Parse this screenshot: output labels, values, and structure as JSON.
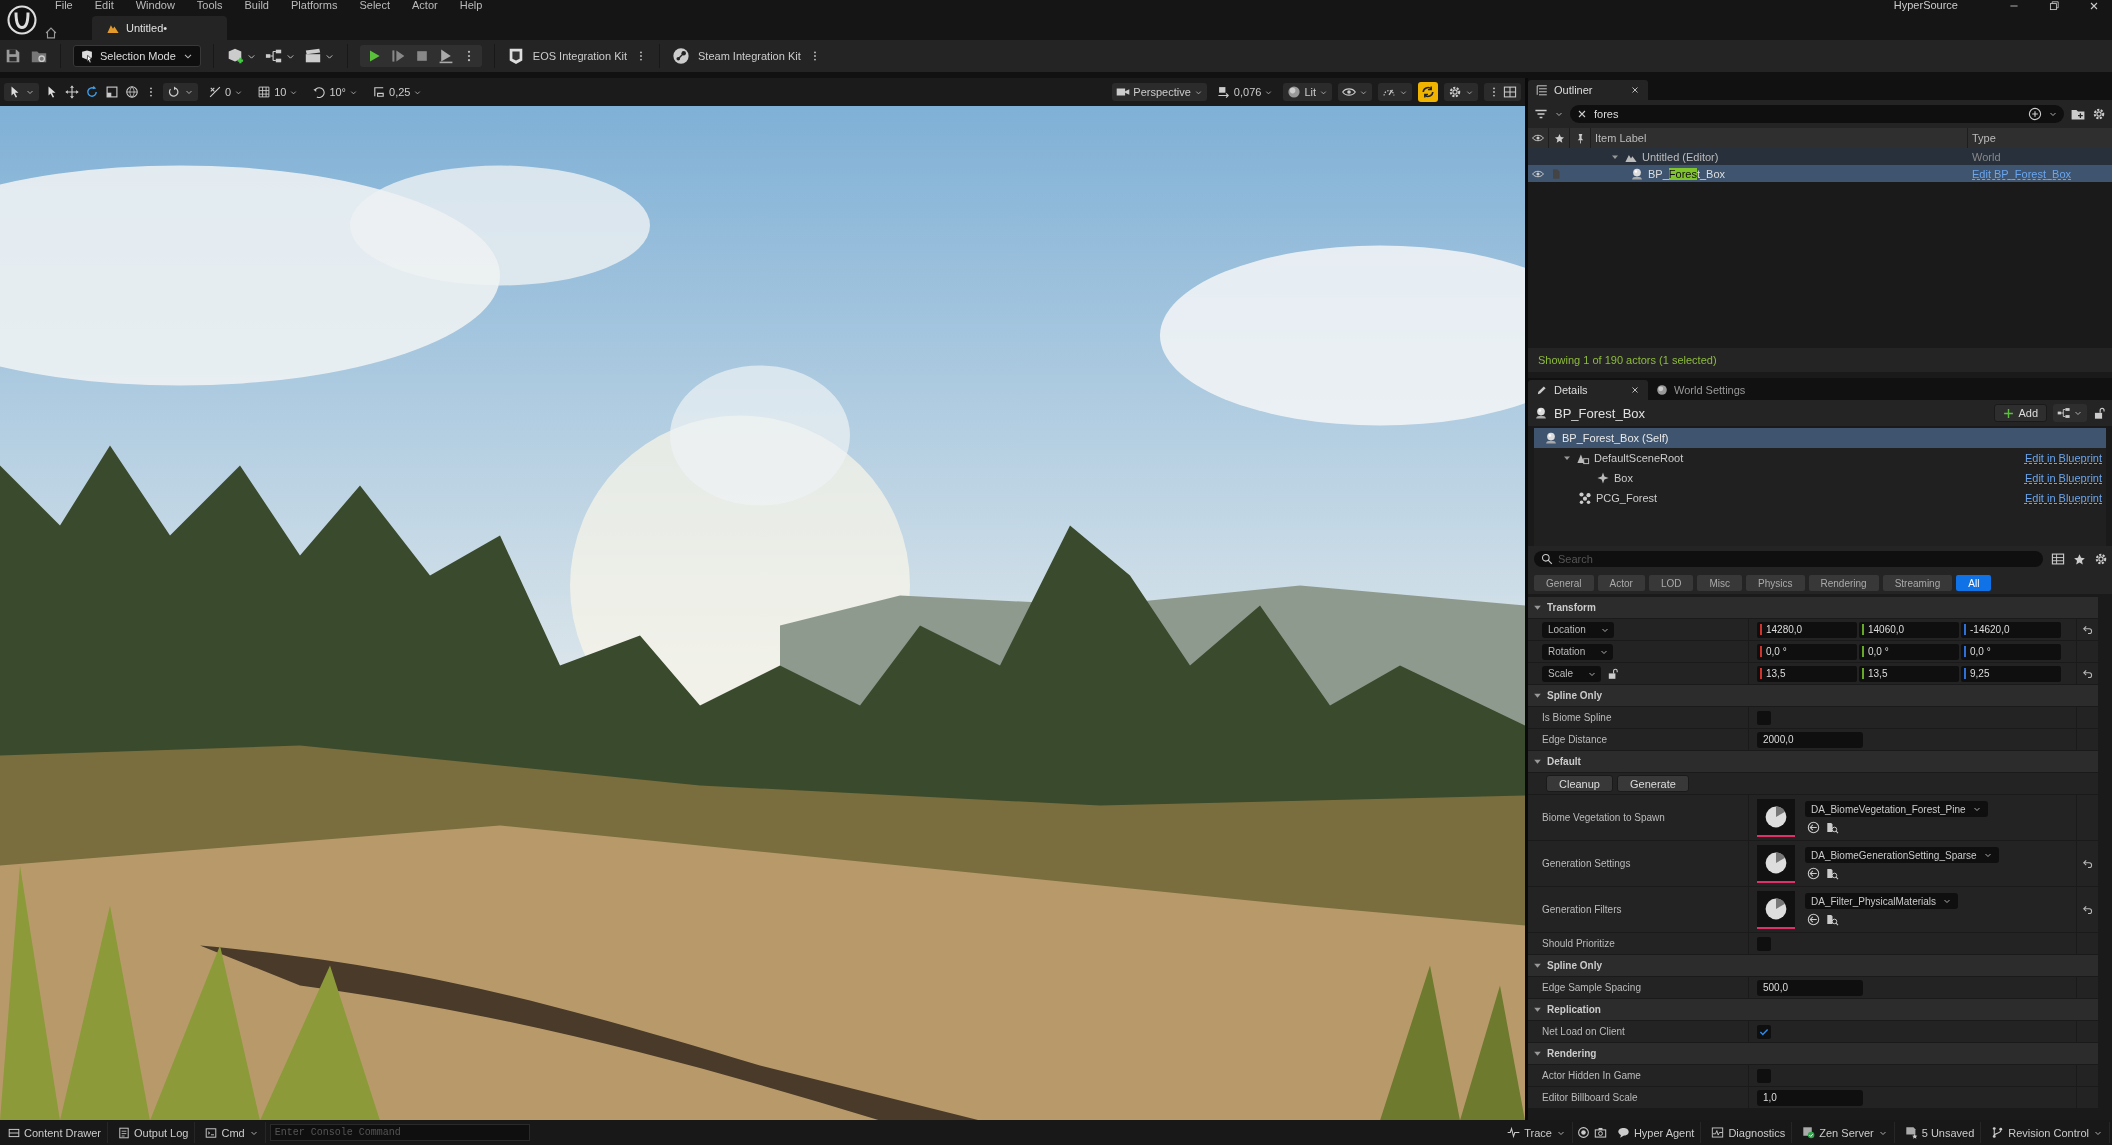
{
  "menu": [
    "File",
    "Edit",
    "Window",
    "Tools",
    "Build",
    "Platforms",
    "Select",
    "Actor",
    "Help"
  ],
  "app_title": "HyperSource",
  "document_tab": {
    "label": "Untitled•"
  },
  "toolbar": {
    "mode_button": "Selection Mode",
    "plugins": [
      {
        "label": "EOS Integration Kit",
        "kind": "shield"
      },
      {
        "label": "Steam Integration Kit",
        "kind": "disc"
      }
    ]
  },
  "viewport_toolbar": {
    "snap": [
      "0",
      "10",
      "10°",
      "0,25"
    ],
    "camera": "Perspective",
    "camera_speed": "0,076",
    "view_mode": "Lit",
    "game_view": {
      "on": true
    }
  },
  "outliner": {
    "title": "Outliner",
    "search": {
      "value": "fores"
    },
    "columns": [
      "Item Label",
      "Type"
    ],
    "tree": [
      {
        "label": "Untitled (Editor)",
        "type": "World",
        "kind": "world",
        "expanded": true,
        "selected": false,
        "children": [
          {
            "label": "BP_Forest_Box",
            "type": "Edit BP_Forest_Box",
            "kind": "actor",
            "selected": true
          }
        ]
      }
    ],
    "status": "Showing 1 of 190 actors (1 selected)"
  },
  "details": {
    "tabs": [
      {
        "label": "Details",
        "selected": true
      },
      {
        "label": "World Settings",
        "selected": false
      }
    ],
    "actor_name": "BP_Forest_Box",
    "add_button": "Add",
    "components": [
      {
        "label": "BP_Forest_Box (Self)",
        "kind": "actor",
        "selected": true
      },
      {
        "label": "DefaultSceneRoot",
        "kind": "scene",
        "selected": false,
        "expanded": true,
        "link": "Edit in Blueprint",
        "children": [
          {
            "label": "Box",
            "kind": "shape",
            "selected": false,
            "link": "Edit in Blueprint"
          }
        ]
      },
      {
        "label": "PCG_Forest",
        "kind": "pcg",
        "selected": false,
        "link": "Edit in Blueprint"
      }
    ],
    "search": {
      "placeholder": "Search"
    },
    "filters": [
      {
        "label": "General",
        "selected": false
      },
      {
        "label": "Actor",
        "selected": false
      },
      {
        "label": "LOD",
        "selected": false
      },
      {
        "label": "Misc",
        "selected": false
      },
      {
        "label": "Physics",
        "selected": false
      },
      {
        "label": "Rendering",
        "selected": false
      },
      {
        "label": "Streaming",
        "selected": false
      },
      {
        "label": "All",
        "selected": true
      }
    ],
    "sections": [
      {
        "title": "Transform",
        "expanded": true,
        "rows": [
          {
            "kind": "vector",
            "label": "Location",
            "values": [
              "14280,0",
              "14060,0",
              "-14620,0"
            ],
            "reset": true
          },
          {
            "kind": "vector",
            "label": "Rotation",
            "values": [
              "0,0 °",
              "0,0 °",
              "0,0 °"
            ],
            "reset": false
          },
          {
            "kind": "vector",
            "label": "Scale",
            "values": [
              "13,5",
              "13,5",
              "9,25"
            ],
            "lock": true,
            "reset": true
          }
        ]
      },
      {
        "title": "Spline Only",
        "expanded": true,
        "rows": [
          {
            "kind": "checkbox",
            "label": "Is Biome Spline",
            "checked": false
          },
          {
            "kind": "number",
            "label": "Edge Distance",
            "value": "2000,0"
          }
        ]
      },
      {
        "title": "Default",
        "expanded": true,
        "rows": [
          {
            "kind": "buttons",
            "buttons": [
              "Cleanup",
              "Generate"
            ]
          },
          {
            "kind": "asset",
            "label": "Biome Vegetation to Spawn",
            "value": "DA_BiomeVegetation_Forest_Pine",
            "reset": false
          },
          {
            "kind": "asset",
            "label": "Generation Settings",
            "value": "DA_BiomeGenerationSetting_Sparse",
            "reset": true
          },
          {
            "kind": "asset",
            "label": "Generation Filters",
            "value": "DA_Filter_PhysicalMaterials",
            "reset": true
          },
          {
            "kind": "checkbox",
            "label": "Should Prioritize",
            "checked": false
          }
        ]
      },
      {
        "title": "Spline Only",
        "expanded": true,
        "rows": [
          {
            "kind": "number",
            "label": "Edge Sample Spacing",
            "value": "500,0"
          }
        ]
      },
      {
        "title": "Replication",
        "expanded": true,
        "rows": [
          {
            "kind": "checkbox",
            "label": "Net Load on Client",
            "checked": true
          }
        ]
      },
      {
        "title": "Rendering",
        "expanded": true,
        "rows": [
          {
            "kind": "checkbox",
            "label": "Actor Hidden In Game",
            "checked": false
          },
          {
            "kind": "number",
            "label": "Editor Billboard Scale",
            "value": "1,0"
          }
        ]
      }
    ]
  },
  "status_bar": {
    "left": [
      {
        "label": "Content Drawer",
        "kind": "drawer"
      },
      {
        "label": "Output Log",
        "kind": "log"
      },
      {
        "label": "Cmd",
        "kind": "cmd"
      }
    ],
    "console": {
      "placeholder": "Enter Console Command"
    },
    "right": [
      {
        "label": "Trace",
        "kind": "trace"
      },
      {
        "label": "Hyper Agent",
        "kind": "chat"
      },
      {
        "label": "Diagnostics",
        "kind": "diag"
      },
      {
        "label": "Zen Server",
        "kind": "zen"
      },
      {
        "label": "5 Unsaved",
        "kind": "unsaved"
      },
      {
        "label": "Revision Control",
        "kind": "branch"
      }
    ]
  }
}
